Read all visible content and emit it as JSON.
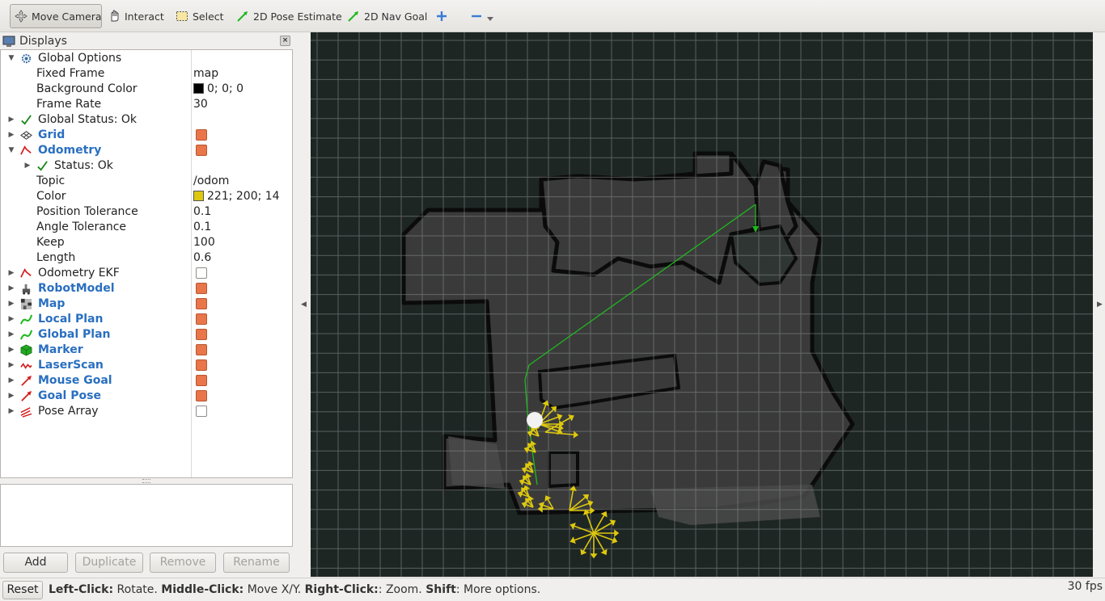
{
  "toolbar": {
    "items": [
      {
        "label": "Move Camera",
        "icon": "move-camera-icon",
        "active": true
      },
      {
        "label": "Interact",
        "icon": "hand-icon"
      },
      {
        "label": "Select",
        "icon": "select-icon"
      },
      {
        "label": "2D Pose Estimate",
        "icon": "green-arrow-icon"
      },
      {
        "label": "2D Nav Goal",
        "icon": "green-arrow-icon"
      }
    ],
    "add_tool_icon": "plus-icon",
    "remove_tool_icon": "minus-icon"
  },
  "displays": {
    "title": "Displays",
    "close_glyph": "×",
    "rows": [
      {
        "label": "Global Options"
      },
      {
        "label": "Fixed Frame",
        "value": "map"
      },
      {
        "label": "Background Color",
        "value": "0; 0; 0",
        "color": "#000000"
      },
      {
        "label": "Frame Rate",
        "value": "30"
      },
      {
        "label": "Global Status: Ok"
      },
      {
        "label": "Grid",
        "checked": true
      },
      {
        "label": "Odometry",
        "checked": true
      },
      {
        "label": "Status: Ok"
      },
      {
        "label": "Topic",
        "value": "/odom"
      },
      {
        "label": "Color",
        "value": "221; 200; 14",
        "color": "#ddc80e"
      },
      {
        "label": "Position Tolerance",
        "value": "0.1"
      },
      {
        "label": "Angle Tolerance",
        "value": "0.1"
      },
      {
        "label": "Keep",
        "value": "100"
      },
      {
        "label": "Length",
        "value": "0.6"
      },
      {
        "label": "Odometry EKF",
        "checked": false
      },
      {
        "label": "RobotModel",
        "checked": true
      },
      {
        "label": "Map",
        "checked": true
      },
      {
        "label": "Local Plan",
        "checked": true
      },
      {
        "label": "Global Plan",
        "checked": true
      },
      {
        "label": "Marker",
        "checked": true
      },
      {
        "label": "LaserScan",
        "checked": true
      },
      {
        "label": "Mouse Goal",
        "checked": true
      },
      {
        "label": "Goal Pose",
        "checked": true
      },
      {
        "label": "Pose Array",
        "checked": false
      }
    ],
    "buttons": {
      "add": "Add",
      "duplicate": "Duplicate",
      "remove": "Remove",
      "rename": "Rename"
    }
  },
  "status_bar": {
    "reset": "Reset",
    "hint_parts": [
      {
        "b": "Left-Click:",
        "t": " Rotate. "
      },
      {
        "b": "Middle-Click:",
        "t": " Move X/Y. "
      },
      {
        "b": "Right-Click:",
        "t": ": Zoom. "
      },
      {
        "b": "Shift",
        "t": ": More options."
      }
    ],
    "fps": "30 fps"
  },
  "colors": {
    "viewport_bg": "#1e2624",
    "map_free": "#3a3a3a",
    "grid": "#8a8f8e",
    "global_plan": "#1fb81f",
    "odometry": "#ddc80e",
    "checkbox_on": "#e8764a"
  }
}
